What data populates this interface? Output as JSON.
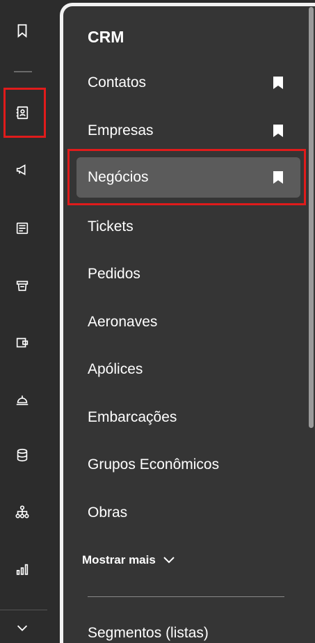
{
  "rail": {
    "icons": [
      "bookmark-icon",
      "contacts-book-icon",
      "megaphone-icon",
      "newspaper-icon",
      "basket-icon",
      "wallet-icon",
      "service-bell-icon",
      "database-icon",
      "org-chart-icon",
      "bar-chart-icon",
      "chevron-down-icon"
    ]
  },
  "panel": {
    "title": "CRM",
    "items": [
      {
        "label": "Contatos",
        "bookmarked": true
      },
      {
        "label": "Empresas",
        "bookmarked": true
      },
      {
        "label": "Negócios",
        "bookmarked": true,
        "active": true
      },
      {
        "label": "Tickets"
      },
      {
        "label": "Pedidos"
      },
      {
        "label": "Aeronaves"
      },
      {
        "label": "Apólices"
      },
      {
        "label": "Embarcações"
      },
      {
        "label": "Grupos Econômicos"
      },
      {
        "label": "Obras"
      }
    ],
    "show_more": "Mostrar mais",
    "segments": "Segmentos (listas)"
  },
  "colors": {
    "highlight": "#e01b1b",
    "active_bg": "#5b5b5b",
    "panel_bg": "#353535"
  }
}
